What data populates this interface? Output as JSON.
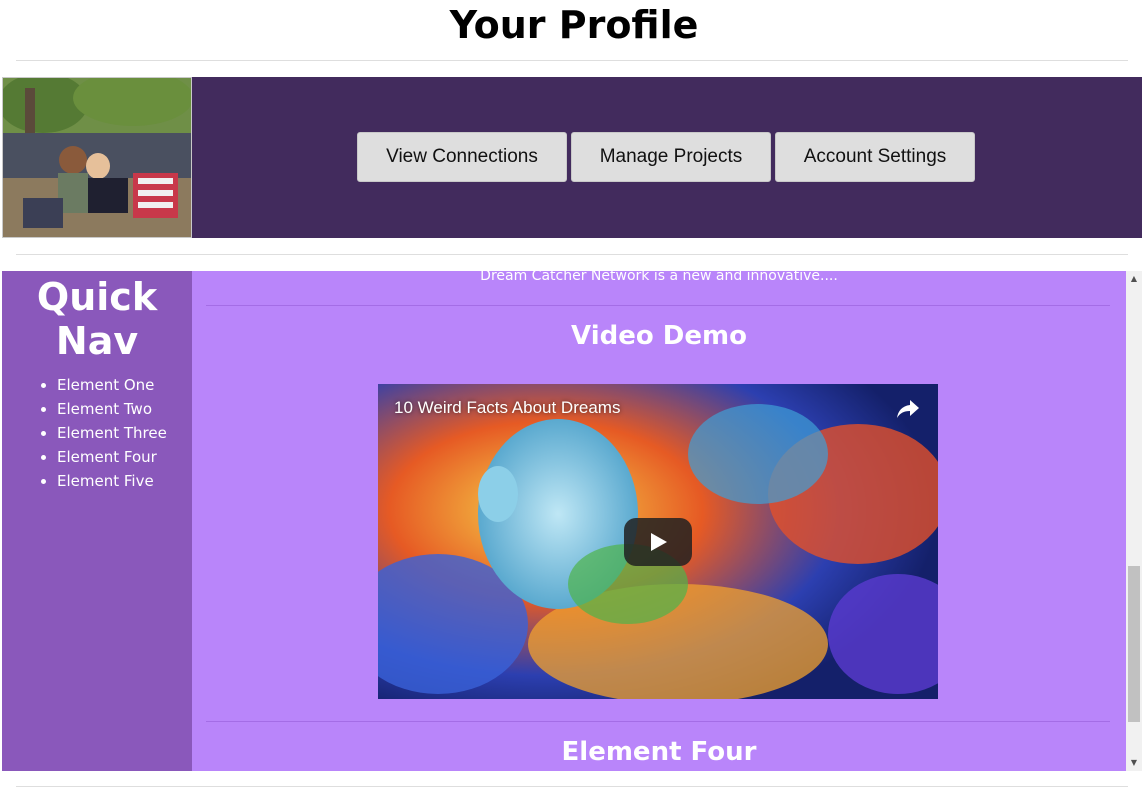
{
  "page": {
    "title": "Your Profile"
  },
  "header": {
    "buttons": {
      "view_connections": "View Connections",
      "manage_projects": "Manage Projects",
      "account_settings": "Account Settings"
    },
    "band_color": "#422b5d"
  },
  "quick_nav": {
    "title_line1": "Quick",
    "title_line2": "Nav",
    "items": [
      {
        "label": "Element One"
      },
      {
        "label": "Element Two"
      },
      {
        "label": "Element Three"
      },
      {
        "label": "Element Four"
      },
      {
        "label": "Element Five"
      }
    ],
    "bg_color": "#8a58bb"
  },
  "content": {
    "intro": "Dream Catcher Network is a new and innovative....",
    "video_section_heading": "Video Demo",
    "video": {
      "title": "10 Weird Facts About Dreams",
      "share_icon": "share-icon",
      "play_icon": "play-icon"
    },
    "next_section_heading": "Element Four",
    "bg_color": "#b985fa"
  }
}
